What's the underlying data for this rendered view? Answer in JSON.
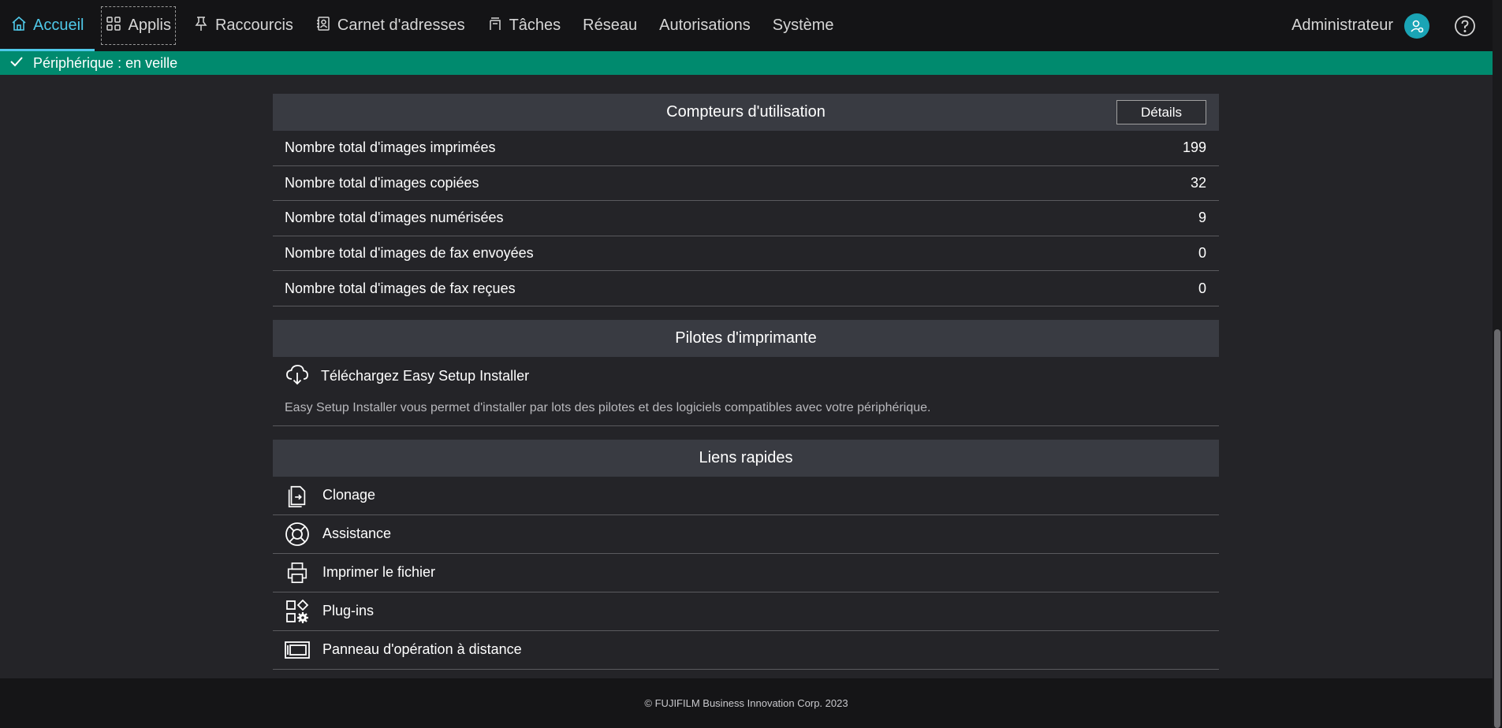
{
  "nav": {
    "items": [
      {
        "label": "Accueil",
        "icon": "home-icon"
      },
      {
        "label": "Applis",
        "icon": "apps-icon"
      },
      {
        "label": "Raccourcis",
        "icon": "pin-icon"
      },
      {
        "label": "Carnet d'adresses",
        "icon": "address-book-icon"
      },
      {
        "label": "Tâches",
        "icon": "tasks-icon"
      },
      {
        "label": "Réseau"
      },
      {
        "label": "Autorisations"
      },
      {
        "label": "Système"
      }
    ],
    "user_label": "Administrateur",
    "accent_color": "#4fc8e8"
  },
  "status": {
    "text": "Périphérique : en veille",
    "color": "#008a6e"
  },
  "counters": {
    "title": "Compteurs d'utilisation",
    "details_label": "Détails",
    "rows": [
      {
        "label": "Nombre total d'images imprimées",
        "value": "199"
      },
      {
        "label": "Nombre total d'images copiées",
        "value": "32"
      },
      {
        "label": "Nombre total d'images numérisées",
        "value": "9"
      },
      {
        "label": "Nombre total d'images de fax envoyées",
        "value": "0"
      },
      {
        "label": "Nombre total d'images de fax reçues",
        "value": "0"
      }
    ]
  },
  "drivers": {
    "title": "Pilotes d'imprimante",
    "download_label": "Téléchargez Easy Setup Installer",
    "description": "Easy Setup Installer vous permet d'installer par lots des pilotes et des logiciels compatibles avec votre périphérique."
  },
  "quicklinks": {
    "title": "Liens rapides",
    "items": [
      {
        "label": "Clonage",
        "icon": "clone-icon"
      },
      {
        "label": "Assistance",
        "icon": "lifebuoy-icon"
      },
      {
        "label": "Imprimer le fichier",
        "icon": "printer-icon"
      },
      {
        "label": "Plug-ins",
        "icon": "plugins-icon"
      },
      {
        "label": "Panneau d'opération à distance",
        "icon": "remote-panel-icon"
      }
    ]
  },
  "footer": {
    "text": "© FUJIFILM Business Innovation Corp. 2023"
  }
}
